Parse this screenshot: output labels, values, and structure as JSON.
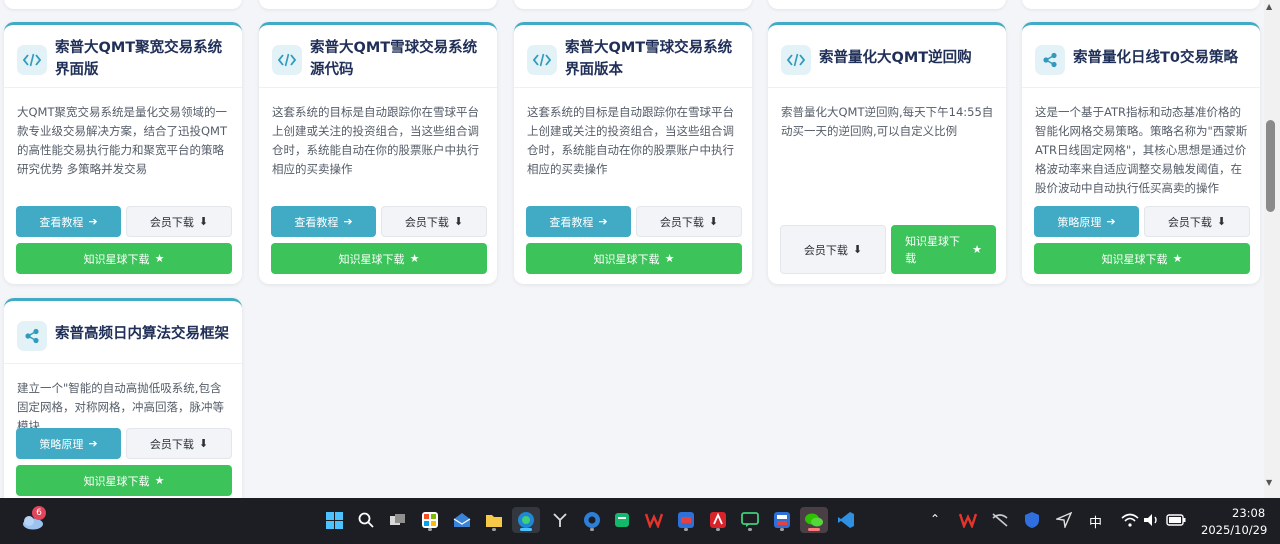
{
  "cards": [
    {
      "title": "索普大QMT聚宽交易系统界面版",
      "icon": "code-icon",
      "desc": "大QMT聚宽交易系统是量化交易领域的一款专业级交易解决方案，结合了迅投QMT的高性能交易执行能力和聚宽平台的策略研究优势 多策略并发交易",
      "btn1": "查看教程",
      "btn2": "会员下载",
      "btn3": "知识星球下载"
    },
    {
      "title": "索普大QMT雪球交易系统源代码",
      "icon": "code-icon",
      "desc": "这套系统的目标是自动跟踪你在雪球平台上创建或关注的投资组合，当这些组合调仓时，系统能自动在你的股票账户中执行相应的买卖操作",
      "btn1": "查看教程",
      "btn2": "会员下载",
      "btn3": "知识星球下载"
    },
    {
      "title": "索普大QMT雪球交易系统界面版本",
      "icon": "code-icon",
      "desc": "这套系统的目标是自动跟踪你在雪球平台上创建或关注的投资组合，当这些组合调仓时，系统能自动在你的股票账户中执行相应的买卖操作",
      "btn1": "查看教程",
      "btn2": "会员下载",
      "btn3": "知识星球下载"
    },
    {
      "title": "索普量化大QMT逆回购",
      "icon": "code-icon",
      "desc": "索普量化大QMT逆回购,每天下午14:55自动买一天的逆回购,可以自定义比例",
      "btn1": "会员下载",
      "btn2": "知识星球下载"
    },
    {
      "title": "索普量化日线T0交易策略",
      "icon": "share-icon",
      "desc": "这是一个基于ATR指标和动态基准价格的智能化网格交易策略。策略名称为\"西蒙斯ATR日线固定网格\"，其核心思想是通过价格波动率来自适应调整交易触发阈值，在股价波动中自动执行低买高卖的操作",
      "btn1": "策略原理",
      "btn2": "会员下载",
      "btn3": "知识星球下载"
    },
    {
      "title": "索普高频日内算法交易框架",
      "icon": "share-icon",
      "desc": "建立一个\"智能的自动高抛低吸系统,包含固定网格，对称网格，冲高回落，脉冲等模块",
      "btn1": "策略原理",
      "btn2": "会员下载",
      "btn3": "知识星球下载"
    }
  ],
  "taskbar": {
    "weather_badge": "6",
    "lang": "中",
    "time": "23:08",
    "date": "2025/10/29"
  }
}
